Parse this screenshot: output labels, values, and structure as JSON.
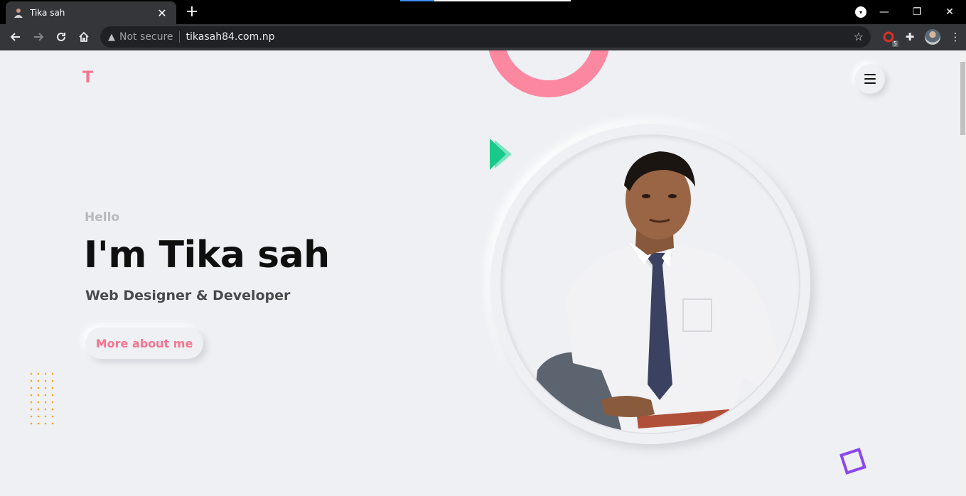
{
  "browser": {
    "tab_title": "Tika sah",
    "tab_close": "✕",
    "new_tab": "+",
    "security_label": "Not secure",
    "url": "tikasah84.com.np",
    "extension_badge": "5",
    "accent_color": "#3c8cf0"
  },
  "site": {
    "logo_letter": "T",
    "greeting": "Hello",
    "heading": "I'm Tika sah",
    "subtitle": "Web Designer & Developer",
    "cta_label": "More about me",
    "brand_color": "#f5758f",
    "ring_color": "#fc87a0",
    "play_color": "#19c98b",
    "square_color": "#8a46ef",
    "dots_color": "#f4a11d"
  },
  "icons": {
    "back": "back-arrow-icon",
    "forward": "forward-arrow-icon",
    "reload": "reload-icon",
    "home": "home-icon",
    "warning": "warning-icon",
    "star": "star-icon",
    "extensions": "puzzle-icon",
    "menu": "hamburger-icon"
  }
}
